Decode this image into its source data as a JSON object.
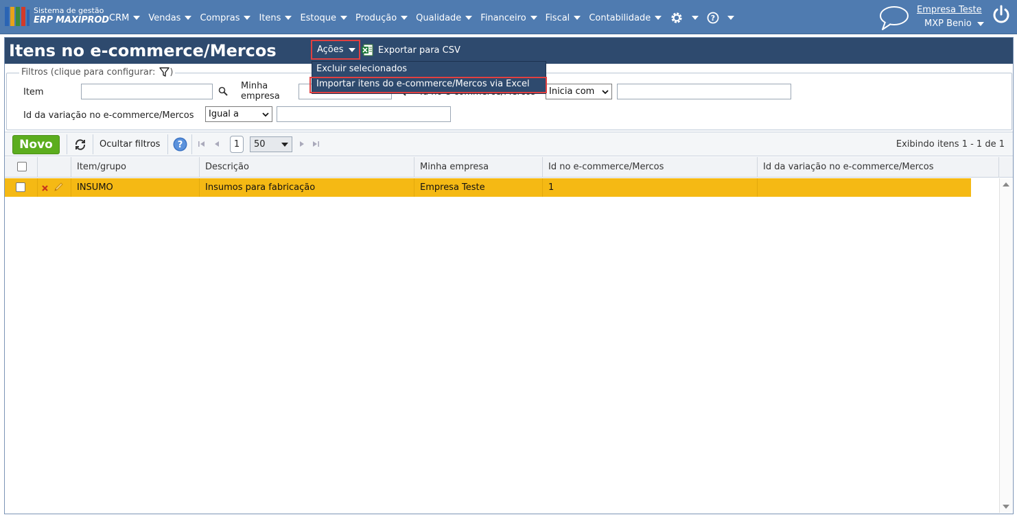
{
  "header": {
    "logo_line1": "Sistema de gestão",
    "logo_line2": "ERP MAXIPROD",
    "nav": [
      "CRM",
      "Vendas",
      "Compras",
      "Itens",
      "Estoque",
      "Produção",
      "Qualidade",
      "Financeiro",
      "Fiscal",
      "Contabilidade"
    ],
    "company": "Empresa Teste",
    "user": "MXP Benio",
    "brand_color": "#4f7bb0"
  },
  "page": {
    "title": "Itens no e-commerce/Mercos",
    "actions_label": "Ações",
    "export_label": "Exportar para CSV",
    "menu": [
      "Excluir selecionados",
      "Importar itens do e-commerce/Mercos via Excel"
    ]
  },
  "filters": {
    "legend": "Filtros (clique para configurar:",
    "legend_close": ")",
    "item_label": "Item",
    "item_value": "",
    "empresa_label": "Minha empresa",
    "empresa_value": "",
    "id_label": "Id no e-commerce/Mercos",
    "id_operator": "Inicia com",
    "id_value": "",
    "variacao_label": "Id da variação no e-commerce/Mercos",
    "variacao_operator": "Igual a",
    "variacao_value": ""
  },
  "toolbar": {
    "novo": "Novo",
    "hide_filters": "Ocultar filtros",
    "page": "1",
    "page_size": "50",
    "display": "Exibindo itens 1 - 1 de 1"
  },
  "grid": {
    "columns": [
      "Item/grupo",
      "Descrição",
      "Minha empresa",
      "Id no e-commerce/Mercos",
      "Id da variação no e-commerce/Mercos"
    ],
    "rows": [
      {
        "item": "INSUMO",
        "descricao": "Insumos para fabricação",
        "empresa": "Empresa Teste",
        "id": "1",
        "variacao": ""
      }
    ],
    "selected_row_color": "#f5b914"
  }
}
